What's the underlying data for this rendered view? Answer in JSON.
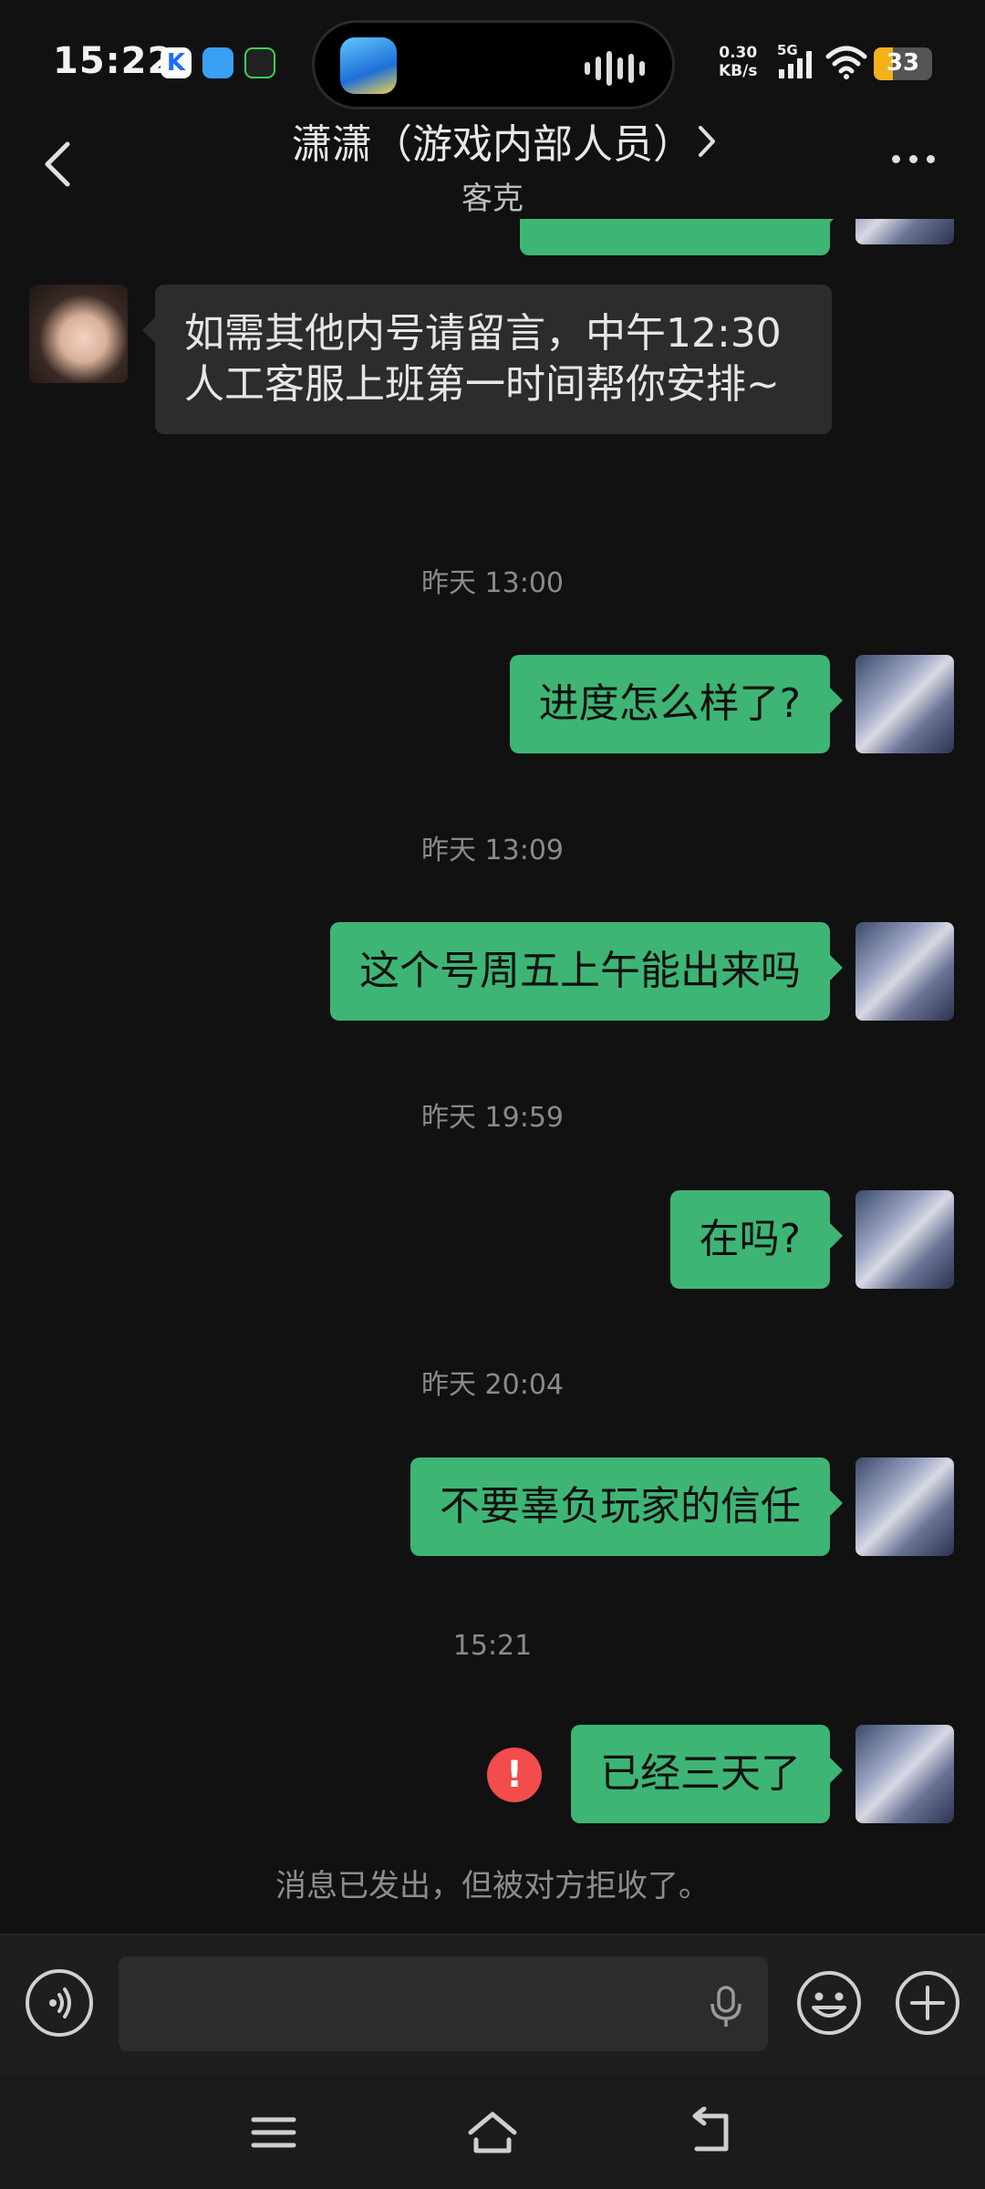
{
  "status_bar": {
    "time": "15:22",
    "app_icons": [
      "k-app-icon",
      "blue-app-icon",
      "green-app-icon"
    ],
    "network_speed_value": "0.30",
    "network_speed_unit": "KB/s",
    "network_type": "5G",
    "battery_level": "33",
    "battery_fraction": 0.33
  },
  "header": {
    "title": "潇潇（游戏内部人员）",
    "subtitle": "客克"
  },
  "messages": [
    {
      "type": "text",
      "from": "them",
      "text": "如需其他内号请留言，中午12:30人工客服上班第一时间帮你安排~"
    },
    {
      "type": "timestamp",
      "text": "昨天 13:00"
    },
    {
      "type": "text",
      "from": "me",
      "text": "进度怎么样了?"
    },
    {
      "type": "timestamp",
      "text": "昨天 13:09"
    },
    {
      "type": "text",
      "from": "me",
      "text": "这个号周五上午能出来吗"
    },
    {
      "type": "timestamp",
      "text": "昨天 19:59"
    },
    {
      "type": "text",
      "from": "me",
      "text": "在吗?"
    },
    {
      "type": "timestamp",
      "text": "昨天 20:04"
    },
    {
      "type": "text",
      "from": "me",
      "text": "不要辜负玩家的信任"
    },
    {
      "type": "timestamp",
      "text": "15:21"
    },
    {
      "type": "text",
      "from": "me",
      "text": "已经三天了",
      "error": "!"
    }
  ],
  "notice": "消息已发出，但被对方拒收了。",
  "input_bar": {
    "value": "",
    "icons": [
      "voice-icon",
      "mic-icon",
      "emoji-icon",
      "plus-icon"
    ]
  },
  "nav_bar": {
    "icons": [
      "menu-icon",
      "home-icon",
      "back-icon"
    ]
  },
  "colors": {
    "background": "#111111",
    "my_bubble": "#3eb575",
    "their_bubble": "#2c2c2c",
    "error": "#f24c4c",
    "battery": "#f3b21b"
  }
}
